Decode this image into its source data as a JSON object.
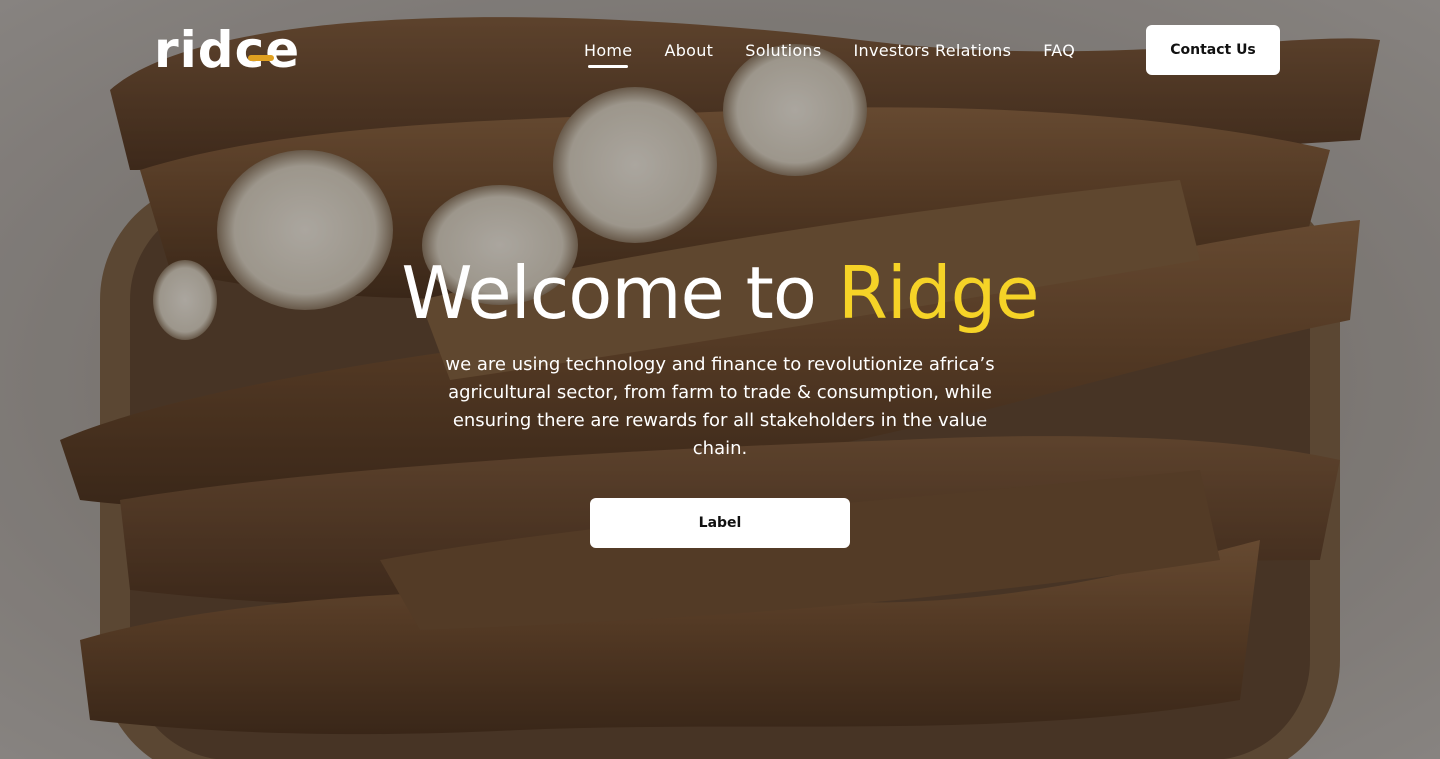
{
  "brand": {
    "logo_text_prefix": "rid",
    "logo_text_mid": "c",
    "logo_text_suffix": "e",
    "logo_accent_color": "#e0a020"
  },
  "nav": {
    "items": [
      {
        "label": "Home",
        "active": true
      },
      {
        "label": "About",
        "active": false
      },
      {
        "label": "Solutions",
        "active": false
      },
      {
        "label": "Investors Relations",
        "active": false
      },
      {
        "label": "FAQ",
        "active": false
      }
    ],
    "contact_label": "Contact Us"
  },
  "hero": {
    "title_part1": "Welcome to ",
    "title_part2": "Ridge",
    "title_accent_color": "#f5d327",
    "subtitle": "we are using technology and finance to revolutionize africa’s agricultural sector, from farm to trade & consumption, while ensuring there are rewards for all stakeholders in the value chain.",
    "cta_label": "Label"
  },
  "colors": {
    "background_dim": "#6e6a66",
    "button_bg": "#ffffff",
    "text_primary": "#ffffff"
  }
}
